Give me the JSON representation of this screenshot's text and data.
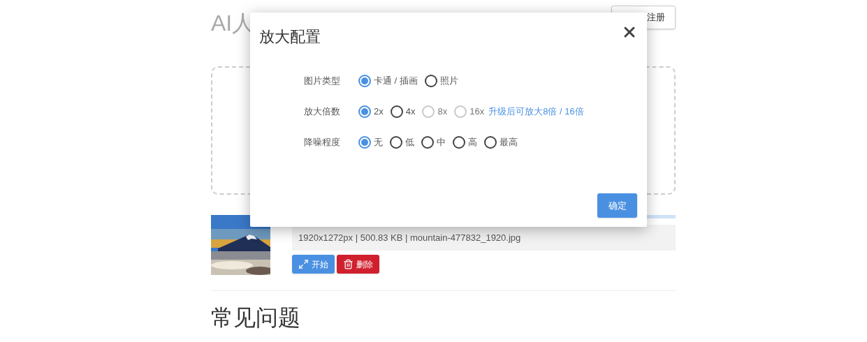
{
  "page": {
    "title": "AI人",
    "register_button": "注册",
    "upload": {
      "progress": {
        "level": 1
      }
    },
    "file": {
      "info": "1920x1272px | 500.83 KB | mountain-477832_1920.jpg",
      "actions": [
        {
          "kind": "start",
          "label": "开始"
        },
        {
          "kind": "delete",
          "label": "删除"
        }
      ]
    },
    "faq_heading": "常见问题"
  },
  "dialog": {
    "title": "放大配置",
    "settings": [
      {
        "label": "图片类型",
        "options": [
          {
            "label": "卡通 / 插画",
            "selected": true,
            "disabled": false
          },
          {
            "label": "照片",
            "selected": false,
            "disabled": false
          }
        ]
      },
      {
        "label": "放大倍数",
        "options": [
          {
            "label": "2x",
            "selected": true,
            "disabled": false
          },
          {
            "label": "4x",
            "selected": false,
            "disabled": false
          },
          {
            "label": "8x",
            "selected": false,
            "disabled": true
          },
          {
            "label": "16x",
            "selected": false,
            "disabled": true
          }
        ],
        "upgrade_link": "升级后可放大8倍 / 16倍"
      },
      {
        "label": "降噪程度",
        "options": [
          {
            "label": "无",
            "selected": true,
            "disabled": false
          },
          {
            "label": "低",
            "selected": false,
            "disabled": false
          },
          {
            "label": "中",
            "selected": false,
            "disabled": false
          },
          {
            "label": "高",
            "selected": false,
            "disabled": false
          },
          {
            "label": "最高",
            "selected": false,
            "disabled": false
          }
        ]
      }
    ],
    "confirm_button": "确定"
  }
}
